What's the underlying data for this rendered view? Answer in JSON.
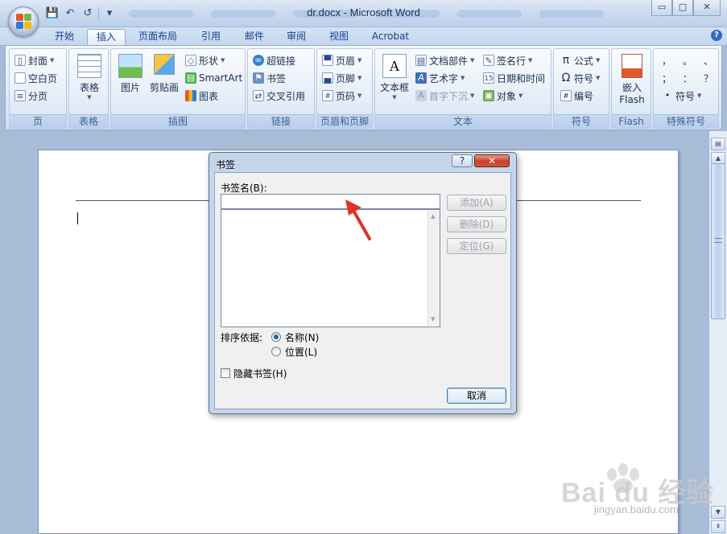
{
  "window": {
    "title": "dr.docx - Microsoft Word",
    "controls": [
      "▭",
      "□",
      "✕"
    ]
  },
  "ribbon": {
    "tabs": [
      "开始",
      "插入",
      "页面布局",
      "引用",
      "邮件",
      "审阅",
      "视图",
      "Acrobat"
    ],
    "active_tab": "插入",
    "groups": {
      "page": {
        "label": "页",
        "items": [
          "封面",
          "空白页",
          "分页"
        ]
      },
      "table": {
        "label": "表格",
        "button": "表格"
      },
      "illustrations": {
        "label": "插图",
        "picture": "图片",
        "clipart": "剪贴画",
        "shapes": "形状",
        "smartart": "SmartArt",
        "chart": "图表"
      },
      "links": {
        "label": "链接",
        "hyperlink": "超链接",
        "bookmark": "书签",
        "crossref": "交叉引用"
      },
      "header_footer": {
        "label": "页眉和页脚",
        "header": "页眉",
        "footer": "页脚",
        "page_number": "页码"
      },
      "text": {
        "label": "文本",
        "textbox": "文本框",
        "quickparts": "文档部件",
        "wordart": "艺术字",
        "dropcap": "首字下沉",
        "signature": "签名行",
        "datetime": "日期和时间",
        "object": "对象"
      },
      "symbols": {
        "label": "符号",
        "equation": "公式",
        "symbol": "符号",
        "number": "编号"
      },
      "flash": {
        "label": "Flash",
        "embed_line1": "嵌入",
        "embed_line2": "Flash"
      },
      "special": {
        "label": "特殊符号",
        "chars": [
          "，",
          "。",
          "、",
          "；",
          "：",
          "？"
        ],
        "symbol": "符号"
      }
    }
  },
  "dialog": {
    "title": "书签",
    "help": "?",
    "close": "✕",
    "name_label": "书签名(B):",
    "name_value": "",
    "buttons": {
      "add": "添加(A)",
      "delete": "删除(D)",
      "goto": "定位(G)",
      "cancel": "取消"
    },
    "sort_label": "排序依据:",
    "sort_options": [
      {
        "label": "名称(N)",
        "selected": true
      },
      {
        "label": "位置(L)",
        "selected": false
      }
    ],
    "hidden_bookmarks": {
      "label": "隐藏书签(H)",
      "checked": false
    }
  },
  "watermark": {
    "brand": "Bai du 经验",
    "url": "jingyan.baidu.com"
  },
  "colors": {
    "ribbon_accent": "#15428b",
    "annotation_arrow": "#e0312b",
    "close_red": "#c7402a"
  }
}
